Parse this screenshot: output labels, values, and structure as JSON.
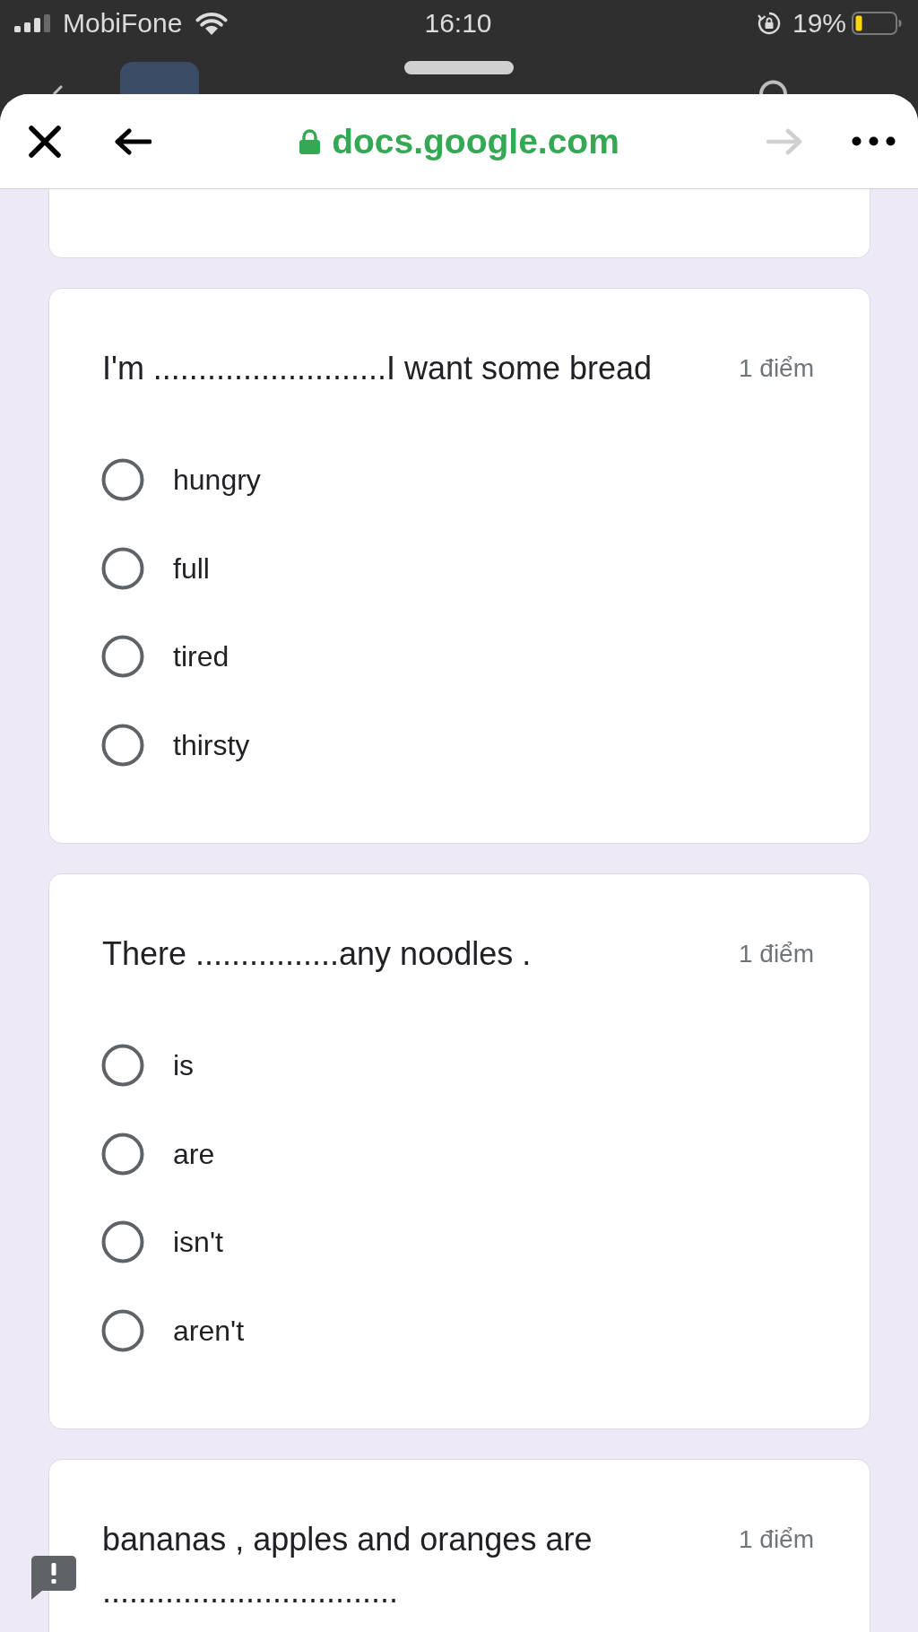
{
  "status_bar": {
    "carrier": "MobiFone",
    "time": "16:10",
    "battery": "19%"
  },
  "browser": {
    "url": "docs.google.com",
    "forward_disabled": true
  },
  "questions": [
    {
      "text": "I'm ..........................I want some bread",
      "points": "1 điểm",
      "options": [
        {
          "label": "hungry",
          "selected": false
        },
        {
          "label": "full",
          "selected": false
        },
        {
          "label": "tired",
          "selected": false
        },
        {
          "label": "thirsty",
          "selected": false
        }
      ]
    },
    {
      "text": "There ................any noodles .",
      "points": "1 điểm",
      "options": [
        {
          "label": "is",
          "selected": false
        },
        {
          "label": "are",
          "selected": false
        },
        {
          "label": "isn't",
          "selected": false
        },
        {
          "label": "aren't",
          "selected": false
        }
      ]
    },
    {
      "text": "bananas , apples and oranges are .................................",
      "points": "1 điểm"
    }
  ]
}
